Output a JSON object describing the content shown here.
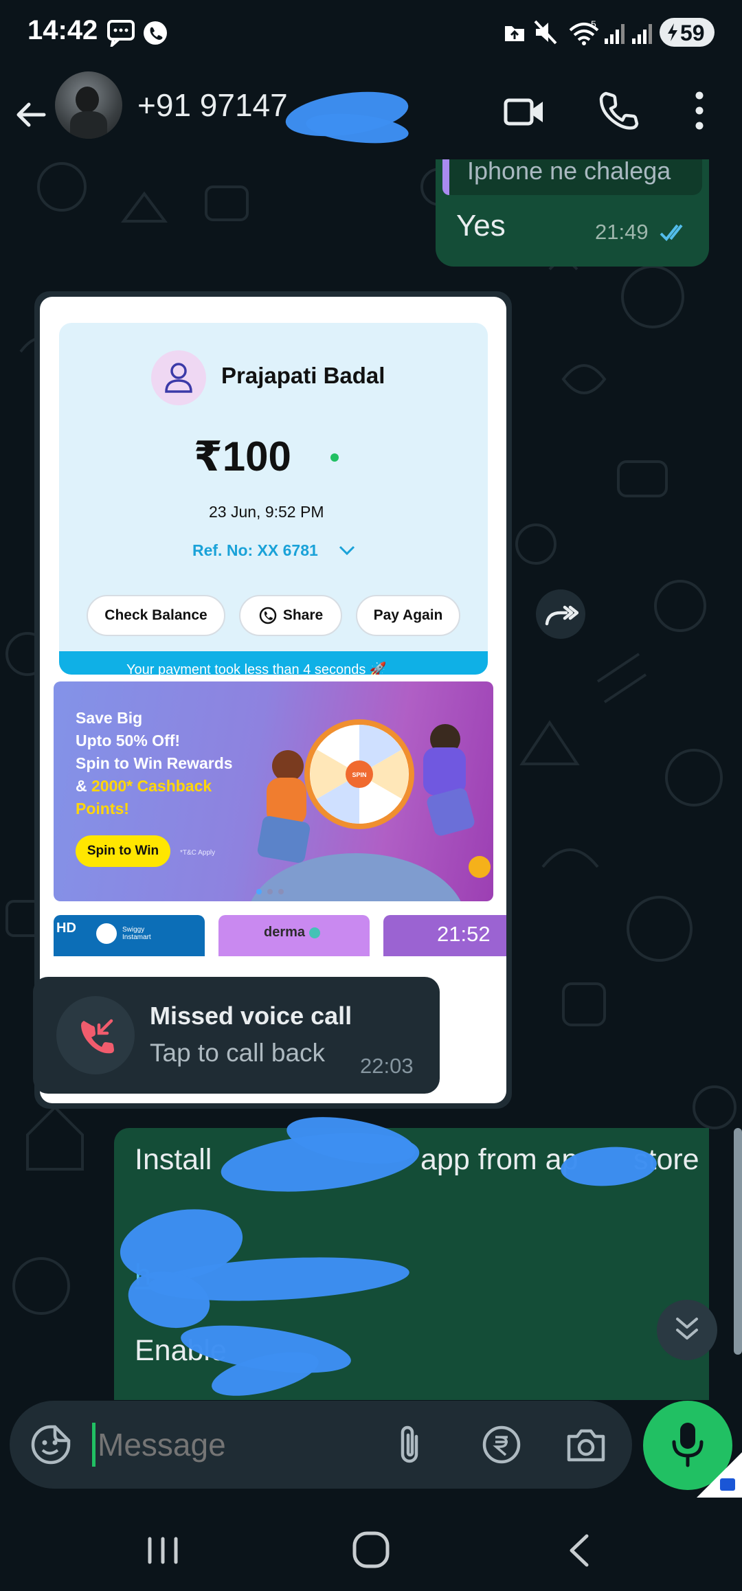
{
  "status_bar": {
    "time": "14:42",
    "battery": "59",
    "icons": [
      "message-icon",
      "whatsapp-icon",
      "upload-icon",
      "mute-icon",
      "wifi-icon",
      "signal-icon",
      "signal-icon-2",
      "battery-icon"
    ]
  },
  "header": {
    "contact_name": "+91 97147",
    "icons": [
      "back-arrow-icon",
      "video-call-icon",
      "voice-call-icon",
      "more-icon"
    ]
  },
  "messages": {
    "reply_quote": "Iphone ne chalega",
    "yes_text": "Yes",
    "yes_time": "21:49",
    "image_time": "21:52",
    "payment": {
      "name": "Prajapati Badal",
      "amount": "₹100",
      "datetime": "23 Jun, 9:52 PM",
      "ref": "Ref. No: XX 6781",
      "check_balance": "Check Balance",
      "share": "Share",
      "pay_again": "Pay Again",
      "speed_note": "Your payment took less than 4 seconds 🚀"
    },
    "banner": {
      "line1": "Save Big",
      "line2": "Upto 50% Off!",
      "line3": "Spin to Win Rewards",
      "line4_prefix": "& ",
      "line4_highlight": "2000* Cashback",
      "line5": "Points!",
      "button": "Spin to Win",
      "tnc": "*T&C Apply",
      "wheel_center": "SPIN"
    },
    "tiles": {
      "hd": "HD",
      "swiggy": "Swiggy Instamart",
      "derma": "derma"
    },
    "missed_call": {
      "title": "Missed voice call",
      "subtitle": "Tap to call back",
      "time": "22:03"
    },
    "install": {
      "line1_a": "Install ",
      "line1_b": "app from ap",
      "line1_c": "store",
      "link_start": "h",
      "line3_start": "Enable"
    }
  },
  "input": {
    "placeholder": "Message"
  },
  "colors": {
    "accent_green": "#21c063",
    "outgoing_bubble": "#144d37",
    "incoming_bubble": "#1f2c34",
    "background": "#0b141a",
    "scribble_blue": "#3d8ff2"
  }
}
